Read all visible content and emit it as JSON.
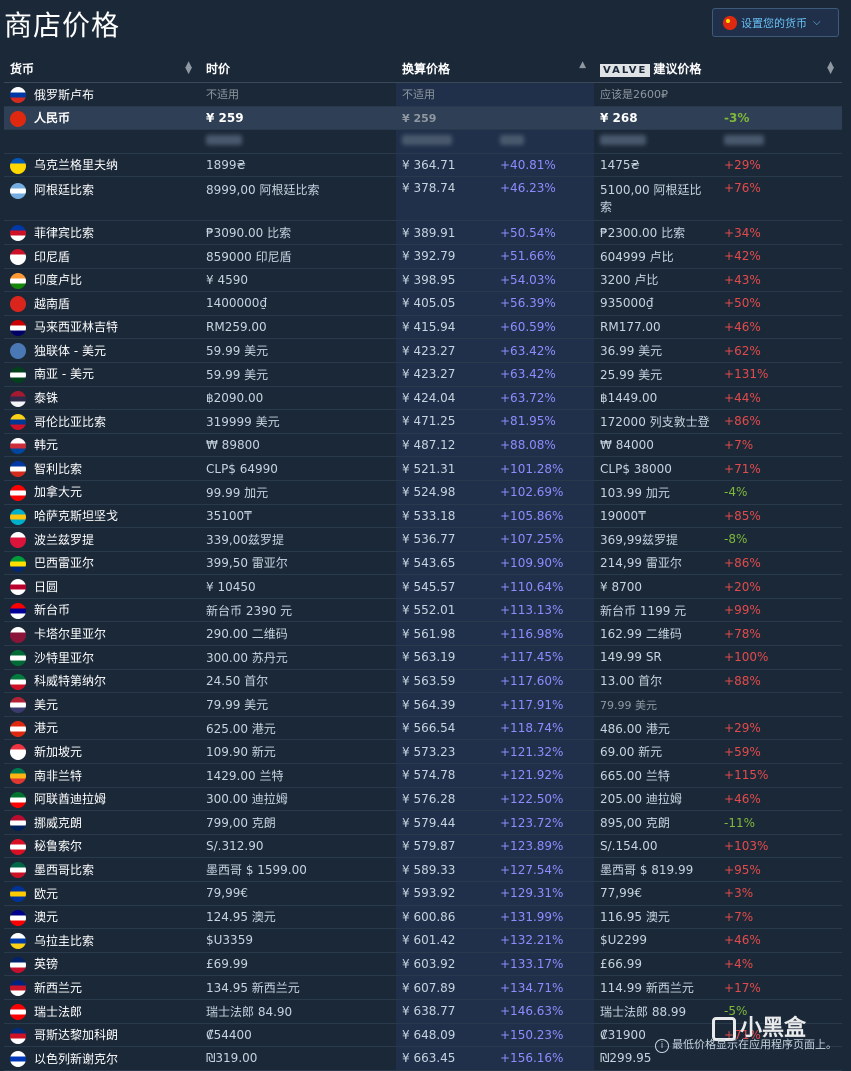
{
  "page": {
    "title": "商店价格",
    "currency_button": "设置您的货币",
    "footnote": "最低价格显示在应用程序页面上。",
    "watermark": "小黑盒"
  },
  "headers": {
    "currency": "货币",
    "price": "时价",
    "converted": "换算价格",
    "valve_badge": "VALVE",
    "suggested": "建议价格"
  },
  "colors": {
    "background": "#1b2838",
    "increase": "#e24b4b",
    "decrease": "#7fb83a",
    "compare": "#8e8cff",
    "accent": "#67c1f5"
  },
  "rows": [
    {
      "name": "俄罗斯卢布",
      "flag": [
        "#ffffff",
        "#0039a6",
        "#d52b1e"
      ],
      "price": "不适用",
      "conv": "不适用",
      "conv_pct": "",
      "sugg": "应该是2600₽",
      "sugg_pct": "",
      "dir": "",
      "muted": true
    },
    {
      "name": "人民币",
      "flag": [
        "#de2910",
        "#de2910",
        "#de2910"
      ],
      "price": "¥ 259",
      "conv": "¥ 259",
      "conv_pct": "",
      "sugg": "¥ 268",
      "sugg_pct": "-3%",
      "dir": "neg",
      "highlight": true
    },
    {
      "name": "",
      "flag": null,
      "price": "",
      "conv": "",
      "conv_pct": "",
      "sugg": "",
      "sugg_pct": "",
      "dir": "",
      "blurred": true
    },
    {
      "name": "乌克兰格里夫纳",
      "flag": [
        "#0057b7",
        "#ffd700",
        "#ffd700"
      ],
      "price": "1899₴",
      "conv": "¥ 364.71",
      "conv_pct": "+40.81%",
      "sugg": "1475₴",
      "sugg_pct": "+29%",
      "dir": "pos"
    },
    {
      "name": "阿根廷比索",
      "flag": [
        "#74acdf",
        "#ffffff",
        "#74acdf"
      ],
      "price": "8999,00 阿根廷比索",
      "conv": "¥ 378.74",
      "conv_pct": "+46.23%",
      "sugg": "5100,00 阿根廷比",
      "sugg2": "索",
      "sugg_pct": "+76%",
      "dir": "pos",
      "tall": true
    },
    {
      "name": "菲律宾比索",
      "flag": [
        "#0038a8",
        "#ce1126",
        "#ffffff"
      ],
      "price": "₱3090.00 比索",
      "conv": "¥ 389.91",
      "conv_pct": "+50.54%",
      "sugg": "₱2300.00 比索",
      "sugg_pct": "+34%",
      "dir": "pos"
    },
    {
      "name": "印尼盾",
      "flag": [
        "#ce1126",
        "#ffffff",
        "#ffffff"
      ],
      "price": "859000 印尼盾",
      "conv": "¥ 392.79",
      "conv_pct": "+51.66%",
      "sugg": "604999 卢比",
      "sugg_pct": "+42%",
      "dir": "pos"
    },
    {
      "name": "印度卢比",
      "flag": [
        "#ff9933",
        "#ffffff",
        "#138808"
      ],
      "price": "¥ 4590",
      "conv": "¥ 398.95",
      "conv_pct": "+54.03%",
      "sugg": "3200 卢比",
      "sugg_pct": "+43%",
      "dir": "pos"
    },
    {
      "name": "越南盾",
      "flag": [
        "#da251d",
        "#da251d",
        "#da251d"
      ],
      "price": "1400000₫",
      "conv": "¥ 405.05",
      "conv_pct": "+56.39%",
      "sugg": "935000₫",
      "sugg_pct": "+50%",
      "dir": "pos"
    },
    {
      "name": "马来西亚林吉特",
      "flag": [
        "#cc0001",
        "#ffffff",
        "#010066"
      ],
      "price": "RM259.00",
      "conv": "¥ 415.94",
      "conv_pct": "+60.59%",
      "sugg": "RM177.00",
      "sugg_pct": "+46%",
      "dir": "pos"
    },
    {
      "name": "独联体 - 美元",
      "flag": [
        "#4a78b5",
        "#4a78b5",
        "#4a78b5"
      ],
      "price": "59.99 美元",
      "conv": "¥ 423.27",
      "conv_pct": "+63.42%",
      "sugg": "36.99 美元",
      "sugg_pct": "+62%",
      "dir": "pos"
    },
    {
      "name": "南亚 - 美元",
      "flag": [
        "#01411c",
        "#ffffff",
        "#01411c"
      ],
      "price": "59.99 美元",
      "conv": "¥ 423.27",
      "conv_pct": "+63.42%",
      "sugg": "25.99 美元",
      "sugg_pct": "+131%",
      "dir": "pos"
    },
    {
      "name": "泰铢",
      "flag": [
        "#a51931",
        "#2d2a4a",
        "#f4f5f8"
      ],
      "price": "฿2090.00",
      "conv": "¥ 424.04",
      "conv_pct": "+63.72%",
      "sugg": "฿1449.00",
      "sugg_pct": "+44%",
      "dir": "pos"
    },
    {
      "name": "哥伦比亚比索",
      "flag": [
        "#fcd116",
        "#003893",
        "#ce1126"
      ],
      "price": "319999 美元",
      "conv": "¥ 471.25",
      "conv_pct": "+81.95%",
      "sugg": "172000 列支敦士登",
      "sugg_pct": "+86%",
      "dir": "pos"
    },
    {
      "name": "韩元",
      "flag": [
        "#ffffff",
        "#cd2e3a",
        "#0047a0"
      ],
      "price": "₩ 89800",
      "conv": "¥ 487.12",
      "conv_pct": "+88.08%",
      "sugg": "₩ 84000",
      "sugg_pct": "+7%",
      "dir": "pos"
    },
    {
      "name": "智利比索",
      "flag": [
        "#0039a6",
        "#ffffff",
        "#d52b1e"
      ],
      "price": "CLP$ 64990",
      "conv": "¥ 521.31",
      "conv_pct": "+101.28%",
      "sugg": "CLP$ 38000",
      "sugg_pct": "+71%",
      "dir": "pos"
    },
    {
      "name": "加拿大元",
      "flag": [
        "#ff0000",
        "#ffffff",
        "#ff0000"
      ],
      "price": "99.99 加元",
      "conv": "¥ 524.98",
      "conv_pct": "+102.69%",
      "sugg": "103.99 加元",
      "sugg_pct": "-4%",
      "dir": "neg"
    },
    {
      "name": "哈萨克斯坦坚戈",
      "flag": [
        "#00afca",
        "#fec50c",
        "#00afca"
      ],
      "price": "35100₸",
      "conv": "¥ 533.18",
      "conv_pct": "+105.86%",
      "sugg": "19000₸",
      "sugg_pct": "+85%",
      "dir": "pos"
    },
    {
      "name": "波兰兹罗提",
      "flag": [
        "#ffffff",
        "#dc143c",
        "#dc143c"
      ],
      "price": "339,00兹罗提",
      "conv": "¥ 536.77",
      "conv_pct": "+107.25%",
      "sugg": "369,99兹罗提",
      "sugg_pct": "-8%",
      "dir": "neg"
    },
    {
      "name": "巴西雷亚尔",
      "flag": [
        "#009c3b",
        "#ffdf00",
        "#002776"
      ],
      "price": "399,50 雷亚尔",
      "conv": "¥ 543.65",
      "conv_pct": "+109.90%",
      "sugg": "214,99 雷亚尔",
      "sugg_pct": "+86%",
      "dir": "pos"
    },
    {
      "name": "日圆",
      "flag": [
        "#ffffff",
        "#bc002d",
        "#ffffff"
      ],
      "price": "¥ 10450",
      "conv": "¥ 545.57",
      "conv_pct": "+110.64%",
      "sugg": "¥ 8700",
      "sugg_pct": "+20%",
      "dir": "pos"
    },
    {
      "name": "新台币",
      "flag": [
        "#fe0000",
        "#000095",
        "#ffffff"
      ],
      "price": "新台币 2390 元",
      "conv": "¥ 552.01",
      "conv_pct": "+113.13%",
      "sugg": "新台币 1199 元",
      "sugg_pct": "+99%",
      "dir": "pos"
    },
    {
      "name": "卡塔尔里亚尔",
      "flag": [
        "#ffffff",
        "#8a1538",
        "#8a1538"
      ],
      "price": "290.00 二维码",
      "conv": "¥ 561.98",
      "conv_pct": "+116.98%",
      "sugg": "162.99 二维码",
      "sugg_pct": "+78%",
      "dir": "pos"
    },
    {
      "name": "沙特里亚尔",
      "flag": [
        "#006c35",
        "#ffffff",
        "#006c35"
      ],
      "price": "300.00 苏丹元",
      "conv": "¥ 563.19",
      "conv_pct": "+117.45%",
      "sugg": "149.99 SR",
      "sugg_pct": "+100%",
      "dir": "pos"
    },
    {
      "name": "科威特第纳尔",
      "flag": [
        "#007a3d",
        "#ffffff",
        "#ce1126"
      ],
      "price": "24.50 首尔",
      "conv": "¥ 563.59",
      "conv_pct": "+117.60%",
      "sugg": "13.00 首尔",
      "sugg_pct": "+88%",
      "dir": "pos"
    },
    {
      "name": "美元",
      "flag": [
        "#b22234",
        "#ffffff",
        "#3c3b6e"
      ],
      "price": "79.99 美元",
      "conv": "¥ 564.39",
      "conv_pct": "+117.91%",
      "sugg": "79.99 美元",
      "sugg_pct": "",
      "dir": "",
      "sugg_muted": true
    },
    {
      "name": "港元",
      "flag": [
        "#de2910",
        "#ffffff",
        "#de2910"
      ],
      "price": "625.00 港元",
      "conv": "¥ 566.54",
      "conv_pct": "+118.74%",
      "sugg": "486.00 港元",
      "sugg_pct": "+29%",
      "dir": "pos"
    },
    {
      "name": "新加坡元",
      "flag": [
        "#ef3340",
        "#ffffff",
        "#ffffff"
      ],
      "price": "109.90 新元",
      "conv": "¥ 573.23",
      "conv_pct": "+121.32%",
      "sugg": "69.00 新元",
      "sugg_pct": "+59%",
      "dir": "pos"
    },
    {
      "name": "南非兰特",
      "flag": [
        "#007a4d",
        "#ffb612",
        "#de3831"
      ],
      "price": "1429.00 兰特",
      "conv": "¥ 574.78",
      "conv_pct": "+121.92%",
      "sugg": "665.00 兰特",
      "sugg_pct": "+115%",
      "dir": "pos"
    },
    {
      "name": "阿联酋迪拉姆",
      "flag": [
        "#00732f",
        "#ffffff",
        "#ff0000"
      ],
      "price": "300.00 迪拉姆",
      "conv": "¥ 576.28",
      "conv_pct": "+122.50%",
      "sugg": "205.00 迪拉姆",
      "sugg_pct": "+46%",
      "dir": "pos"
    },
    {
      "name": "挪威克朗",
      "flag": [
        "#ba0c2f",
        "#ffffff",
        "#00205b"
      ],
      "price": "799,00 克朗",
      "conv": "¥ 579.44",
      "conv_pct": "+123.72%",
      "sugg": "895,00 克朗",
      "sugg_pct": "-11%",
      "dir": "neg"
    },
    {
      "name": "秘鲁索尔",
      "flag": [
        "#d91023",
        "#ffffff",
        "#d91023"
      ],
      "price": "S/.312.90",
      "conv": "¥ 579.87",
      "conv_pct": "+123.89%",
      "sugg": "S/.154.00",
      "sugg_pct": "+103%",
      "dir": "pos"
    },
    {
      "name": "墨西哥比索",
      "flag": [
        "#006847",
        "#ffffff",
        "#ce1126"
      ],
      "price": "墨西哥 $ 1599.00",
      "conv": "¥ 589.33",
      "conv_pct": "+127.54%",
      "sugg": "墨西哥 $ 819.99",
      "sugg_pct": "+95%",
      "dir": "pos"
    },
    {
      "name": "欧元",
      "flag": [
        "#003399",
        "#ffcc00",
        "#003399"
      ],
      "price": "79,99€",
      "conv": "¥ 593.92",
      "conv_pct": "+129.31%",
      "sugg": "77,99€",
      "sugg_pct": "+3%",
      "dir": "pos"
    },
    {
      "name": "澳元",
      "flag": [
        "#00008b",
        "#ffffff",
        "#ff0000"
      ],
      "price": "124.95 澳元",
      "conv": "¥ 600.86",
      "conv_pct": "+131.99%",
      "sugg": "116.95 澳元",
      "sugg_pct": "+7%",
      "dir": "pos"
    },
    {
      "name": "乌拉圭比索",
      "flag": [
        "#ffffff",
        "#0038a8",
        "#fcd116"
      ],
      "price": "$U3359",
      "conv": "¥ 601.42",
      "conv_pct": "+132.21%",
      "sugg": "$U2299",
      "sugg_pct": "+46%",
      "dir": "pos"
    },
    {
      "name": "英镑",
      "flag": [
        "#012169",
        "#ffffff",
        "#c8102e"
      ],
      "price": "£69.99",
      "conv": "¥ 603.92",
      "conv_pct": "+133.17%",
      "sugg": "£66.99",
      "sugg_pct": "+4%",
      "dir": "pos"
    },
    {
      "name": "新西兰元",
      "flag": [
        "#00247d",
        "#cc142b",
        "#ffffff"
      ],
      "price": "134.95 新西兰元",
      "conv": "¥ 607.89",
      "conv_pct": "+134.71%",
      "sugg": "114.99 新西兰元",
      "sugg_pct": "+17%",
      "dir": "pos"
    },
    {
      "name": "瑞士法郎",
      "flag": [
        "#ff0000",
        "#ffffff",
        "#ff0000"
      ],
      "price": "瑞士法郎 84.90",
      "conv": "¥ 638.77",
      "conv_pct": "+146.63%",
      "sugg": "瑞士法郎 88.99",
      "sugg_pct": "-5%",
      "dir": "neg"
    },
    {
      "name": "哥斯达黎加科朗",
      "flag": [
        "#002b7f",
        "#ce1126",
        "#ffffff"
      ],
      "price": "₡54400",
      "conv": "¥ 648.09",
      "conv_pct": "+150.23%",
      "sugg": "₡31900",
      "sugg_pct": "+71%",
      "dir": "pos"
    },
    {
      "name": "以色列新谢克尔",
      "flag": [
        "#ffffff",
        "#0038b8",
        "#ffffff"
      ],
      "price": "₪319.00",
      "conv": "¥ 663.45",
      "conv_pct": "+156.16%",
      "sugg": "₪299.95",
      "sugg_pct": "",
      "dir": ""
    }
  ]
}
